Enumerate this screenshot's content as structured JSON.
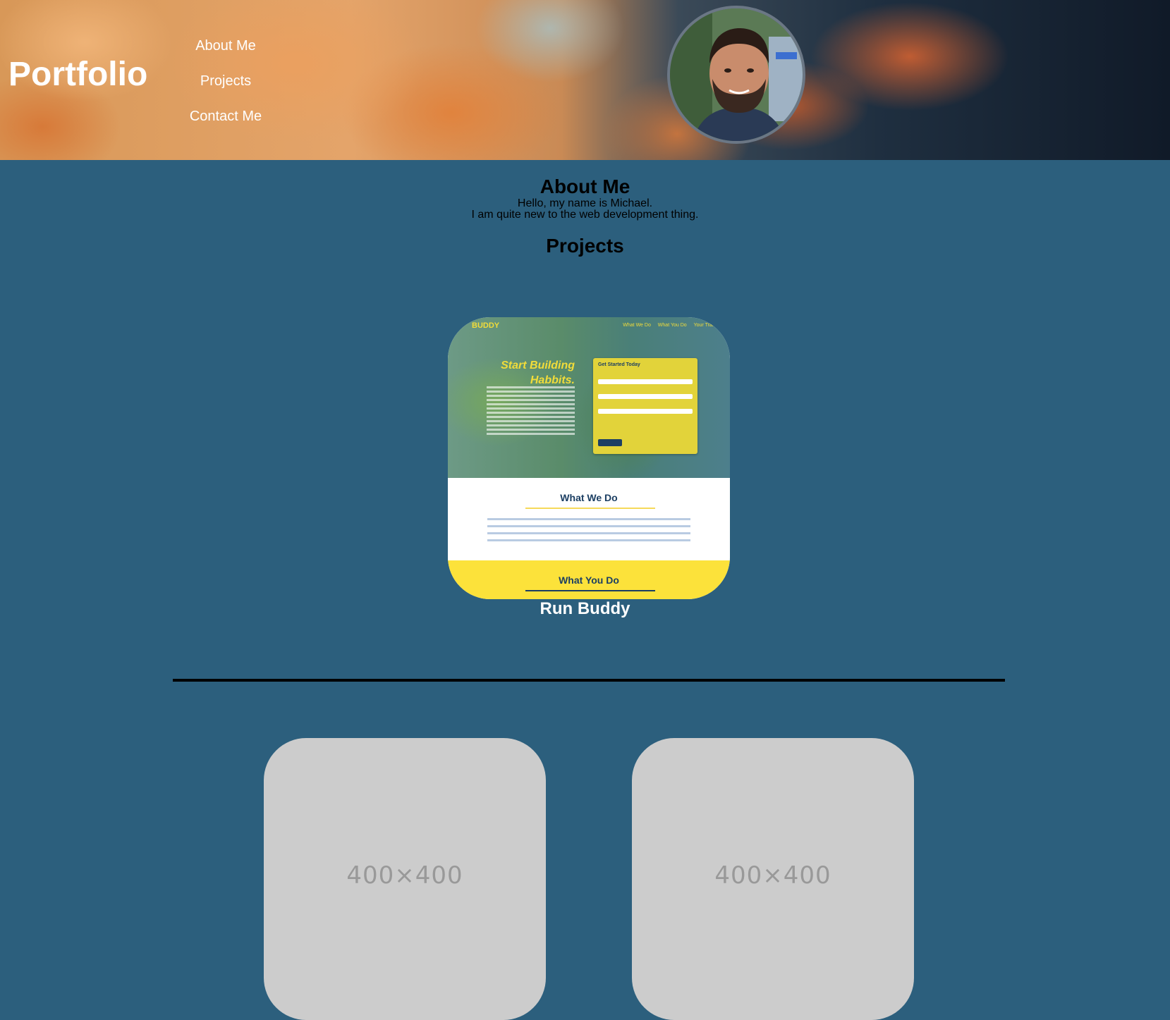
{
  "header": {
    "site_title": "Portfolio",
    "nav": [
      "About Me",
      "Projects",
      "Contact Me"
    ]
  },
  "about": {
    "heading": "About Me",
    "lines": [
      "Hello, my name is Michael.",
      "I am quite new to the web development thing."
    ]
  },
  "projects": {
    "heading": "Projects",
    "featured": {
      "name": "Run Buddy",
      "preview": {
        "brand": "BUDDY",
        "nav": [
          "What We Do",
          "What You Do",
          "Your Trainers"
        ],
        "headline": "Start Building Habbits.",
        "form_title": "Get Started Today",
        "section_1": "What We Do",
        "section_2": "What You Do"
      }
    },
    "placeholders": [
      "400×400",
      "400×400"
    ]
  },
  "colors": {
    "page_background": "#2c5f7d",
    "placeholder_background": "#cccccc",
    "accent_yellow": "#fce23a",
    "divider": "#000000"
  }
}
